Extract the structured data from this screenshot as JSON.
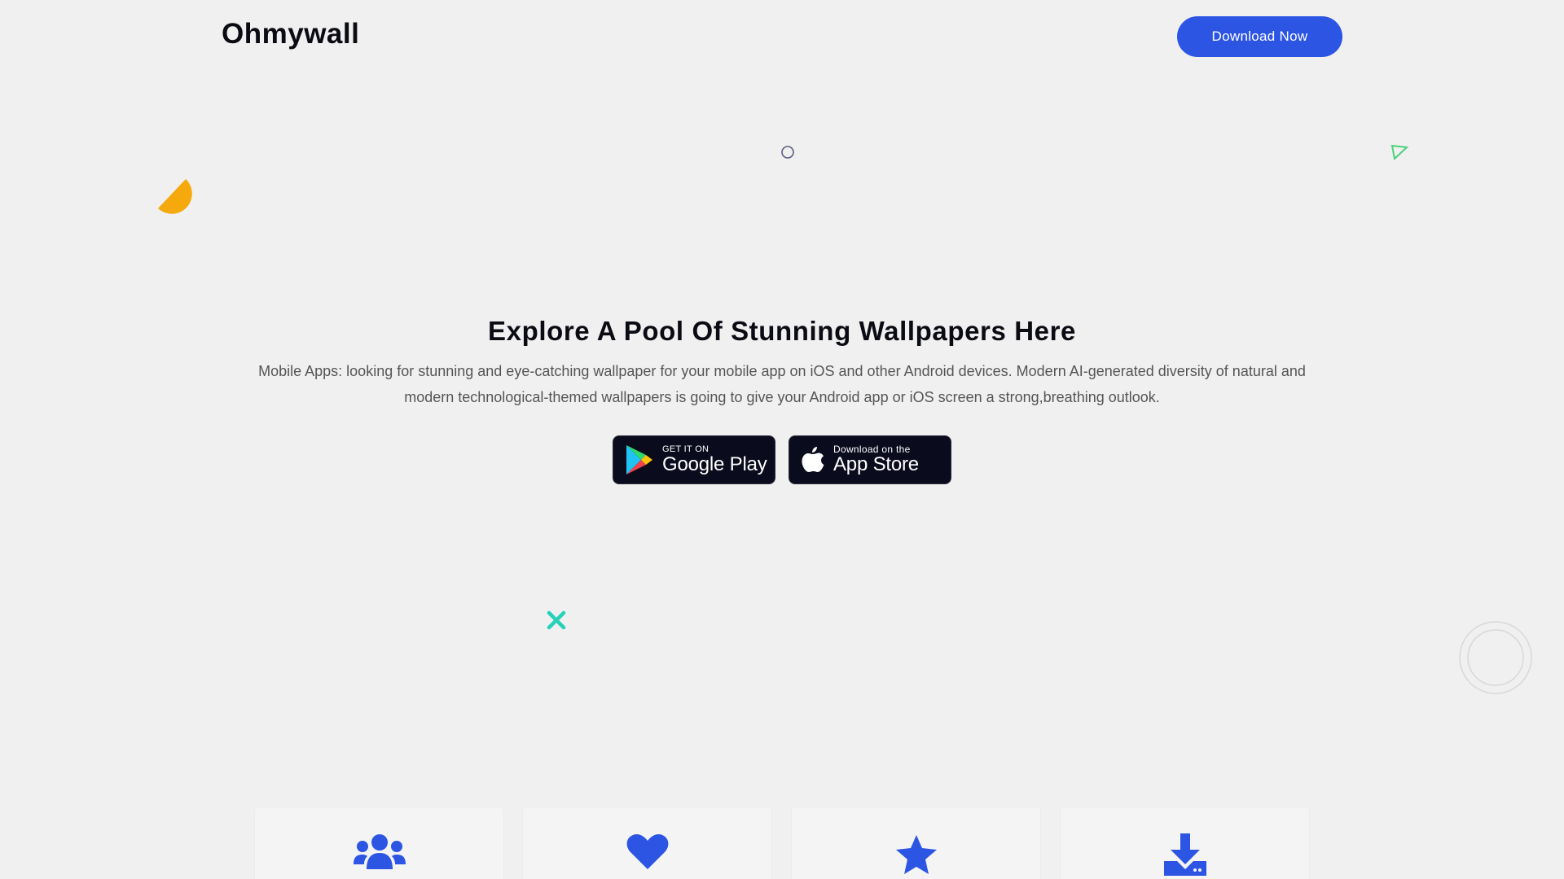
{
  "header": {
    "brand": "Ohmywall",
    "download_label": "Download Now"
  },
  "hero": {
    "title": "Explore A Pool Of Stunning Wallpapers Here",
    "description": "Mobile Apps: looking for stunning and eye-catching wallpaper for your mobile app on iOS and other Android devices. Modern AI-generated diversity of natural and modern technological-themed wallpapers is going to give your Android app or iOS screen a strong,breathing outlook."
  },
  "store_badges": {
    "google_play": {
      "small": "GET IT ON",
      "big": "Google Play"
    },
    "app_store": {
      "small": "Download on the",
      "big": "App Store"
    }
  },
  "feature_cards": [
    {
      "icon": "users-icon"
    },
    {
      "icon": "heart-icon"
    },
    {
      "icon": "star-icon"
    },
    {
      "icon": "download-icon"
    }
  ],
  "colors": {
    "background": "#f0f0f0",
    "accent": "#2c55e4",
    "badge_bg": "#0b0b1e",
    "deco_orange": "#f6a90c",
    "deco_teal": "#27d1b8",
    "deco_green": "#4ad27a"
  }
}
